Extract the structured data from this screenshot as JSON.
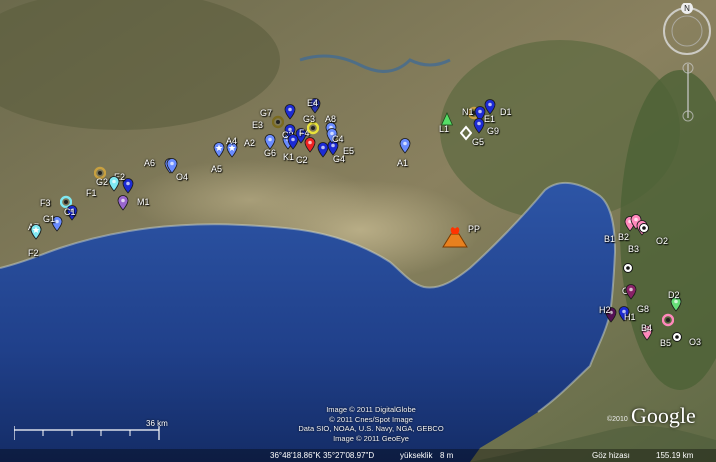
{
  "map": {
    "compass_letter": "N",
    "credits": [
      "Image © 2011 DigitalGlobe",
      "© 2011 Cnes/Spot Image",
      "Data SIO, NOAA, U.S. Navy, NGA, GEBCO",
      "Image © 2011 GeoEye"
    ],
    "scale_label": "36 km",
    "logo_year": "©2010",
    "logo_text": "Google",
    "status": {
      "coords": "36°48'18.86\"K   35°27'08.97\"D",
      "elev_label": "yükseklik",
      "elev_value": "8 m",
      "eye_label": "Göz hizası",
      "eye_value": "155.19 km"
    },
    "volcano_label": "PP"
  },
  "markers": [
    {
      "id": "A1",
      "color": "#6a8cff",
      "shape": "pin"
    },
    {
      "id": "A2",
      "color": "#6a8cff",
      "shape": "pin"
    },
    {
      "id": "A4",
      "color": "#6a8cff",
      "shape": "star"
    },
    {
      "id": "A5",
      "color": "#6a8cff",
      "shape": "star"
    },
    {
      "id": "A6",
      "color": "#6a8cff",
      "shape": "pin"
    },
    {
      "id": "A7",
      "color": "#7fe8f2",
      "shape": "star"
    },
    {
      "id": "A8",
      "color": "#6a8cff",
      "shape": "pin"
    },
    {
      "id": "O4",
      "color": "#6a8cff",
      "shape": "pin"
    },
    {
      "id": "M1",
      "color": "#9966cc",
      "shape": "pin"
    },
    {
      "id": "E2",
      "color": "#1c2bd4",
      "shape": "pin"
    },
    {
      "id": "E3",
      "color": "#7a6a1e",
      "shape": "ring"
    },
    {
      "id": "E4",
      "color": "#2a36b8",
      "shape": "pin"
    },
    {
      "id": "E5",
      "color": "#1c2bd4",
      "shape": "pin"
    },
    {
      "id": "F1",
      "color": "#7fe8f2",
      "shape": "pin"
    },
    {
      "id": "F2",
      "color": "#7fe8f2",
      "shape": "star"
    },
    {
      "id": "F3",
      "color": "#7fe8f2",
      "shape": "ring"
    },
    {
      "id": "F4",
      "color": "#1c2bd4",
      "shape": "pin"
    },
    {
      "id": "G1",
      "color": "#6a8cff",
      "shape": "pin"
    },
    {
      "id": "G2",
      "color": "#c8a040",
      "shape": "ring"
    },
    {
      "id": "G3",
      "color": "#e8e23a",
      "shape": "ring"
    },
    {
      "id": "G4",
      "color": "#1c2bd4",
      "shape": "pin"
    },
    {
      "id": "G6",
      "color": "#6a8cff",
      "shape": "pin"
    },
    {
      "id": "G7",
      "color": "#1c2bd4",
      "shape": "pin"
    },
    {
      "id": "C1",
      "color": "#1c2bd4",
      "shape": "pin"
    },
    {
      "id": "C2",
      "color": "#ee2222",
      "shape": "pin"
    },
    {
      "id": "C3",
      "color": "#1c2bd4",
      "shape": "pin"
    },
    {
      "id": "C4",
      "color": "#6a8cff",
      "shape": "pin"
    },
    {
      "id": "K1",
      "color": "#1c2bd4",
      "shape": "pin"
    },
    {
      "id": "L1",
      "color": "#55dd66",
      "shape": "triangle"
    },
    {
      "id": "N1",
      "color": "#c8a040",
      "shape": "ring"
    },
    {
      "id": "D1",
      "color": "#1c2bd4",
      "shape": "pin"
    },
    {
      "id": "E1",
      "color": "#1c2bd4",
      "shape": "pin"
    },
    {
      "id": "G9",
      "color": "#1c2bd4",
      "shape": "pin"
    },
    {
      "id": "G5",
      "color": "#ffffff",
      "shape": "diamond"
    },
    {
      "id": "B1",
      "color": "#ff88bb",
      "shape": "pin"
    },
    {
      "id": "B2",
      "color": "#ff88bb",
      "shape": "pin"
    },
    {
      "id": "B3",
      "color": "#ff88bb",
      "shape": "pin"
    },
    {
      "id": "O2",
      "color": "#ffffff",
      "shape": "dot"
    },
    {
      "id": "O1",
      "color": "#ffffff",
      "shape": "dot"
    },
    {
      "id": "D2",
      "color": "#66dd77",
      "shape": "pin"
    },
    {
      "id": "H2",
      "color": "#551155",
      "shape": "pin"
    },
    {
      "id": "H1",
      "color": "#1c2bd4",
      "shape": "pin"
    },
    {
      "id": "G8",
      "color": "#882266",
      "shape": "pin"
    },
    {
      "id": "B4",
      "color": "#ff88bb",
      "shape": "pin"
    },
    {
      "id": "B5",
      "color": "#ff88bb",
      "shape": "ring"
    },
    {
      "id": "O3",
      "color": "#ffffff",
      "shape": "dot"
    }
  ]
}
